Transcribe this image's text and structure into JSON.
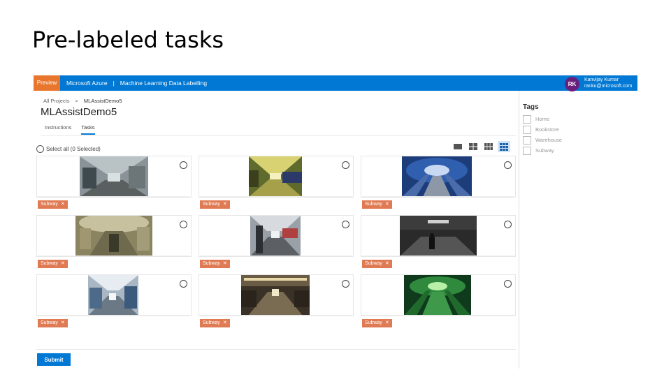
{
  "slide": {
    "title": "Pre-labeled tasks"
  },
  "topbar": {
    "preview": "Preview",
    "brand": "Microsoft Azure",
    "separator": "|",
    "product": "Machine Learning Data Labelling",
    "avatar_initials": "RK",
    "user_name": "Kanvijay Kumar",
    "user_email": "ranku@microsoft.com",
    "bar_color": "#0078d4",
    "preview_color": "#e8762d"
  },
  "breadcrumb": {
    "root": "All Projects",
    "chevron": ">",
    "current": "MLAssistDemo5"
  },
  "project": {
    "title": "MLAssistDemo5"
  },
  "tabs": [
    {
      "label": "Instructions"
    },
    {
      "label": "Tasks"
    }
  ],
  "toolbar": {
    "select_all": "Select all (0 Selected)"
  },
  "tasks": [
    {
      "tag": "Subway",
      "image": "subway-platform-train"
    },
    {
      "tag": "Subway",
      "image": "subway-tunnel-lit"
    },
    {
      "tag": "Subway",
      "image": "subway-escalator-blue"
    },
    {
      "tag": "Subway",
      "image": "subway-escalator-commuter"
    },
    {
      "tag": "Subway",
      "image": "subway-station-platform"
    },
    {
      "tag": "Subway",
      "image": "subway-dark-platform-person"
    },
    {
      "tag": "Subway",
      "image": "subway-station-wide"
    },
    {
      "tag": "Subway",
      "image": "subway-station-hall"
    },
    {
      "tag": "Subway",
      "image": "subway-escalator-green"
    }
  ],
  "tag_close_glyph": "✕",
  "tag_color": "#e07a52",
  "submit": {
    "label": "Submit"
  },
  "tag_panel": {
    "title": "Tags",
    "tags": [
      "Home",
      "Bookstore",
      "Warehouse",
      "Subway"
    ]
  }
}
